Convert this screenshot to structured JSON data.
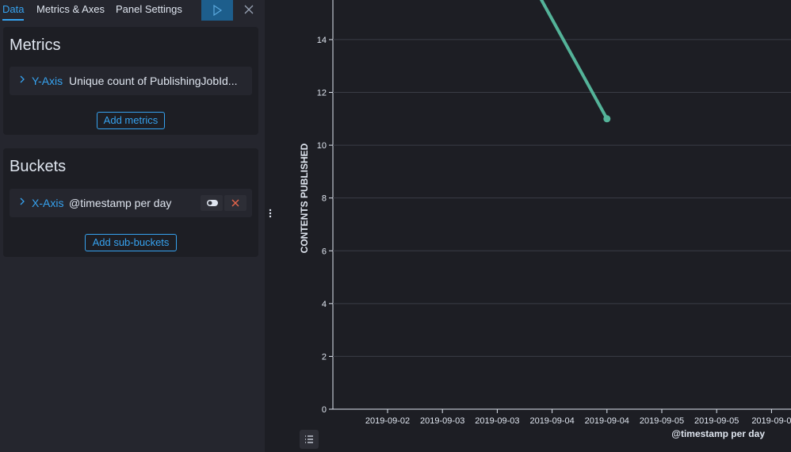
{
  "tabs": [
    {
      "label": "Data",
      "active": true
    },
    {
      "label": "Metrics & Axes",
      "active": false
    },
    {
      "label": "Panel Settings",
      "active": false
    }
  ],
  "icons": {
    "run": "play-icon",
    "close": "close-icon",
    "expand": "chevron-right-icon",
    "toggle": "toggle-icon",
    "remove": "cross-icon",
    "legend": "list-icon",
    "drag": "vertical-dots-icon"
  },
  "metrics": {
    "title": "Metrics",
    "item": {
      "axis": "Y-Axis",
      "description": "Unique count of PublishingJobId..."
    },
    "add_label": "Add metrics"
  },
  "buckets": {
    "title": "Buckets",
    "item": {
      "axis": "X-Axis",
      "description": "@timestamp per day"
    },
    "add_label": "Add sub-buckets"
  },
  "colors": {
    "accent": "#36a2ef",
    "series": "#54b399",
    "remove": "#e7664c"
  },
  "chart_data": {
    "type": "line",
    "ylabel": "CONTENTS PUBLISHED",
    "xlabel": "@timestamp per day",
    "ylim": [
      0,
      15.5
    ],
    "yticks": [
      0,
      2,
      4,
      6,
      8,
      10,
      12,
      14
    ],
    "xticks": [
      "2019-09-02",
      "2019-09-03",
      "2019-09-03",
      "2019-09-04",
      "2019-09-04",
      "2019-09-05",
      "2019-09-05",
      "2019-09-0"
    ],
    "grid": true,
    "series": [
      {
        "x": [
          2.7,
          4.0
        ],
        "values": [
          15.9,
          11
        ]
      }
    ]
  }
}
